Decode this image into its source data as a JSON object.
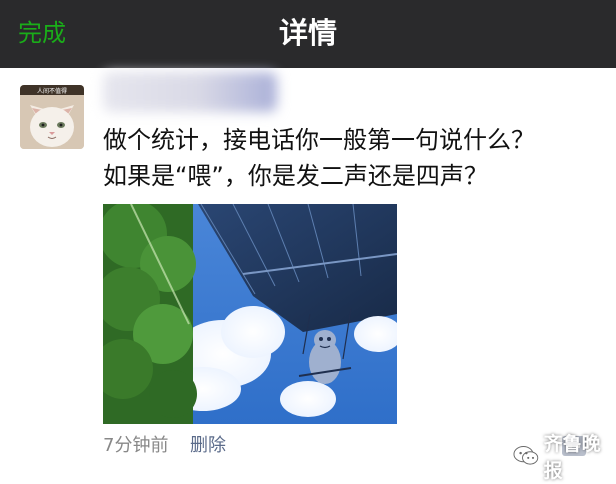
{
  "header": {
    "done_label": "完成",
    "title": "详情",
    "accent_color": "#1aad19",
    "bar_color": "#2a2a2c"
  },
  "post": {
    "avatar": {
      "badge_text": "人间不值得",
      "icon": "cat-avatar-icon"
    },
    "text": "做个统计，接电话你一般第一句说什么？\n如果是“喂”，你是发二声还是四声？",
    "time": "7分钟前",
    "delete_label": "删除",
    "comment_icon": "comment-more-icon"
  },
  "watermark": {
    "text": "齐鲁晚报",
    "icon": "wechat-icon"
  }
}
